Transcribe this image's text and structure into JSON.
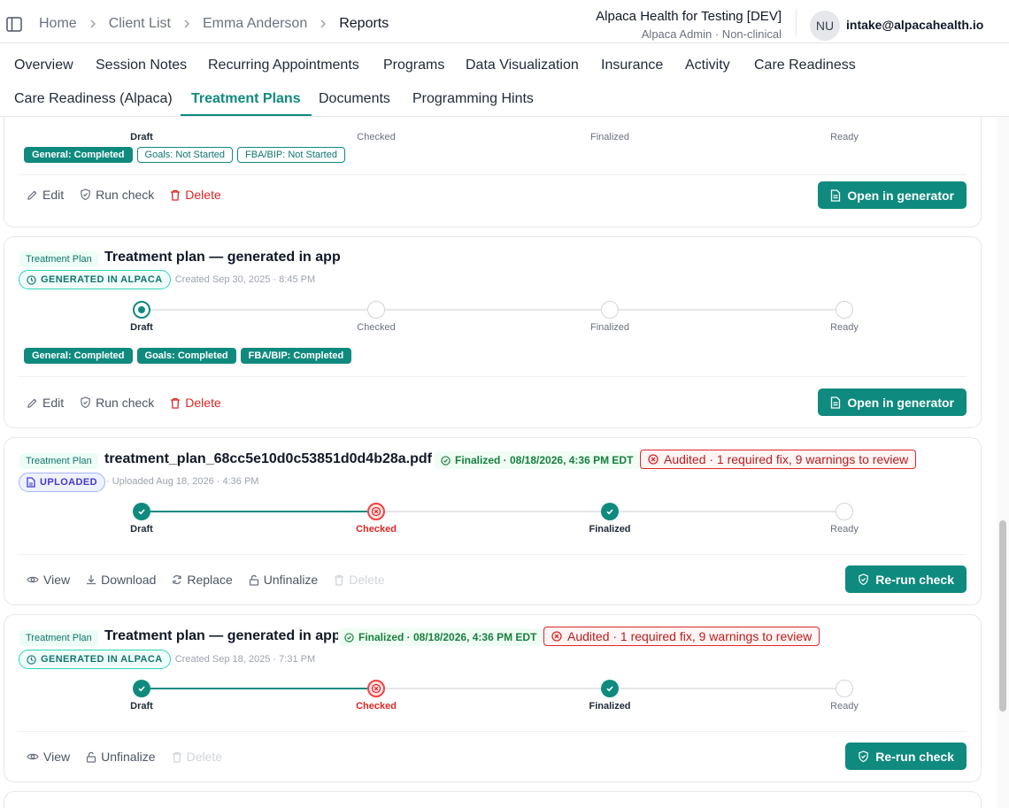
{
  "header": {
    "breadcrumbs": [
      "Home",
      "Client List",
      "Emma Anderson",
      "Reports"
    ],
    "org_name": "Alpaca Health for Testing [DEV]",
    "org_sub": "Alpaca Admin · Non-clinical",
    "user_initials": "NU",
    "user_email": "intake@alpacahealth.io"
  },
  "tabs": [
    "Overview",
    "Session Notes",
    "Recurring Appointments",
    "Programs",
    "Data Visualization",
    "Insurance",
    "Activity",
    "Care Readiness",
    "Care Readiness (Alpaca)",
    "Treatment Plans",
    "Documents",
    "Programming Hints"
  ],
  "active_tab": "Treatment Plans",
  "steps": [
    "Draft",
    "Checked",
    "Finalized",
    "Ready"
  ],
  "colors": {
    "accent": "#0f8a7e",
    "danger": "#dc2626",
    "success": "#15803d"
  },
  "cards": [
    {
      "tags": [
        "General: Completed",
        "Goals: Not Started",
        "FBA/BIP: Not Started"
      ],
      "actions": [
        "Edit",
        "Run check",
        "Delete"
      ],
      "primary": "Open in generator"
    },
    {
      "type_badge": "Treatment Plan",
      "title": "Treatment plan — generated in app",
      "source": "GENERATED IN ALPACA",
      "created": "Created Sep 30, 2025 · 8:45 PM",
      "tags": [
        "General: Completed",
        "Goals: Completed",
        "FBA/BIP: Completed"
      ],
      "actions": [
        "Edit",
        "Run check",
        "Delete"
      ],
      "primary": "Open in generator"
    },
    {
      "type_badge": "Treatment Plan",
      "title": "treatment_plan_68cc5e10d0c53851d0d4b28a.pdf",
      "status": "Finalized · 08/18/2026, 4:36 PM EDT",
      "audit": "Audited · 1 required fix, 9 warnings to review",
      "source": "UPLOADED",
      "created": "Uploaded Aug 18, 2026 · 4:36 PM",
      "actions": [
        "View",
        "Download",
        "Replace",
        "Unfinalize",
        "Delete"
      ],
      "primary": "Re-run check"
    },
    {
      "type_badge": "Treatment Plan",
      "title": "Treatment plan — generated in app",
      "status": "Finalized · 08/18/2026, 4:36 PM EDT",
      "audit": "Audited · 1 required fix, 9 warnings to review",
      "source": "GENERATED IN ALPACA",
      "created": "Created Sep 18, 2025 · 7:31 PM",
      "actions": [
        "View",
        "Unfinalize",
        "Delete"
      ],
      "primary": "Re-run check"
    }
  ]
}
